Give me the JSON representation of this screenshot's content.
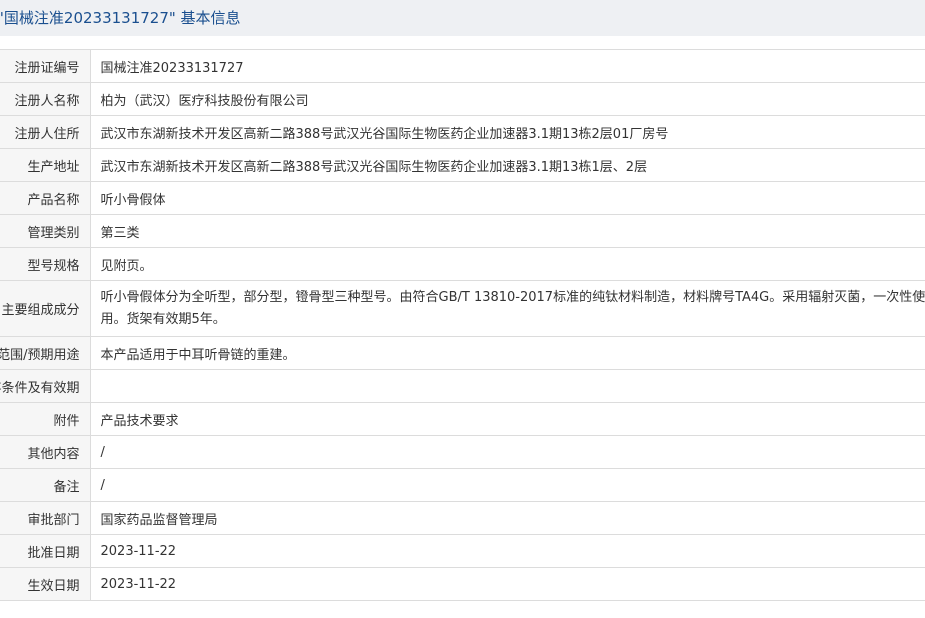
{
  "header": {
    "title": "\"国械注准20233131727\" 基本信息"
  },
  "rows": [
    {
      "label": "注册证编号",
      "value": "国械注准20233131727"
    },
    {
      "label": "注册人名称",
      "value": "柏为（武汉）医疗科技股份有限公司"
    },
    {
      "label": "注册人住所",
      "value": "武汉市东湖新技术开发区高新二路388号武汉光谷国际生物医药企业加速器3.1期13栋2层01厂房号"
    },
    {
      "label": "生产地址",
      "value": "武汉市东湖新技术开发区高新二路388号武汉光谷国际生物医药企业加速器3.1期13栋1层、2层"
    },
    {
      "label": "产品名称",
      "value": "听小骨假体"
    },
    {
      "label": "管理类别",
      "value": "第三类"
    },
    {
      "label": "型号规格",
      "value": "见附页。"
    },
    {
      "label": "主要组成成分",
      "value": "听小骨假体分为全听型，部分型，镫骨型三种型号。由符合GB/T 13810-2017标准的纯钛材料制造，材料牌号TA4G。采用辐射灭菌，一次性使用。货架有效期5年。"
    },
    {
      "label": "适用范围/预期用途",
      "value": "本产品适用于中耳听骨链的重建。"
    },
    {
      "label": "产品储存条件及有效期",
      "value": ""
    },
    {
      "label": "附件",
      "value": "产品技术要求"
    },
    {
      "label": "其他内容",
      "value": "/"
    },
    {
      "label": "备注",
      "value": "/"
    },
    {
      "label": "审批部门",
      "value": "国家药品监督管理局"
    },
    {
      "label": "批准日期",
      "value": "2023-11-22"
    },
    {
      "label": "生效日期",
      "value": "2023-11-22"
    }
  ]
}
